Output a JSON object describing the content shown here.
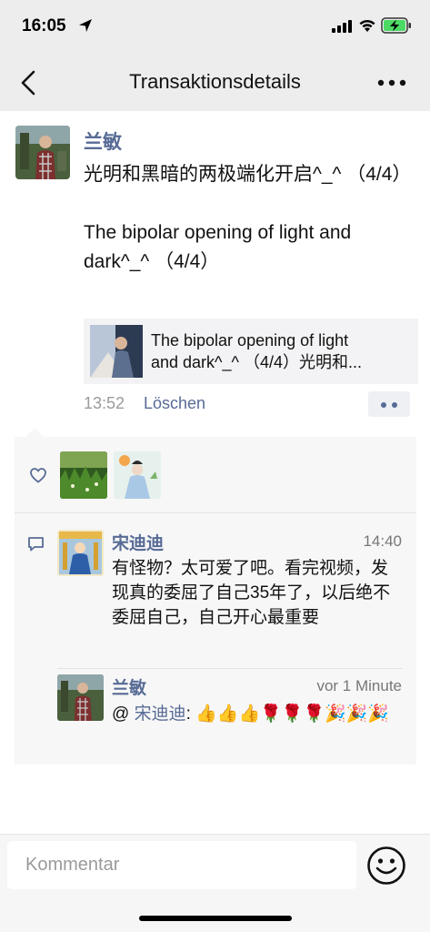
{
  "status_bar": {
    "time": "16:05"
  },
  "nav": {
    "title": "Transaktionsdetails"
  },
  "post": {
    "author": "兰敏",
    "text": "光明和黑暗的两极端化开启^_^ （4/4）\n\nThe bipolar opening of light and dark^_^ （4/4）",
    "share": {
      "line1": "The bipolar opening of light",
      "line2": "and dark^_^ （4/4）光明和..."
    },
    "time": "13:52",
    "delete_label": "Löschen"
  },
  "likes": {
    "icon": "heart-icon",
    "avatars": [
      "like-avatar-1",
      "like-avatar-2"
    ]
  },
  "comments": [
    {
      "author": "宋迪迪",
      "time": "14:40",
      "text": "有怪物？太可爱了吧。看完视频，发现真的委屈了自己35年了，以后绝不委屈自己，自己开心最重要"
    },
    {
      "author": "兰敏",
      "time": "vor 1 Minute",
      "mention_prefix": "@ ",
      "mention": "宋迪迪",
      "text": ": 👍👍👍🌹🌹🌹🎉🎉🎉"
    }
  ],
  "input": {
    "placeholder": "Kommentar"
  },
  "colors": {
    "link": "#576b95",
    "background_gray": "#ededed",
    "battery_green": "#4cd964"
  }
}
